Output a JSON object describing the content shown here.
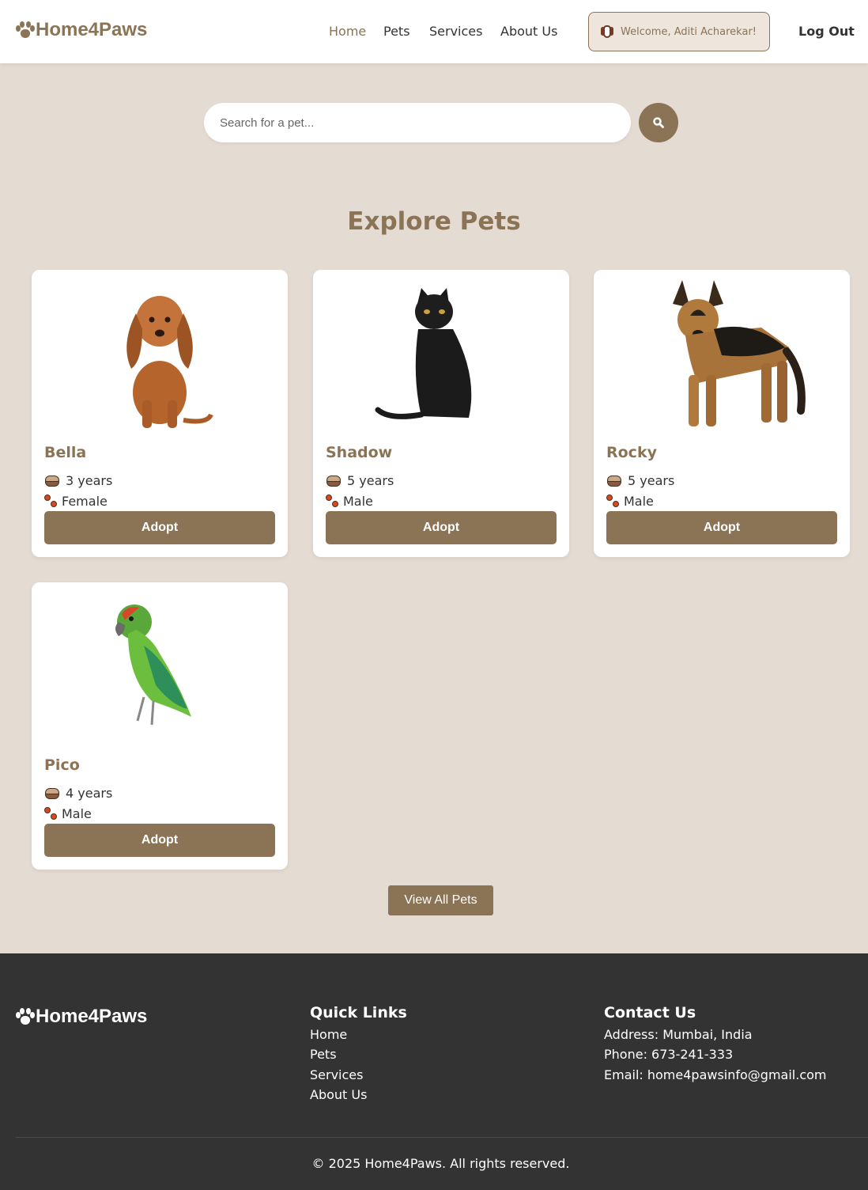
{
  "brand": {
    "name": "Home4Paws",
    "accent": "#8b7355",
    "background": "#e4dbd2",
    "footer_bg": "#333333"
  },
  "nav": {
    "items": [
      {
        "label": "Home",
        "active": true
      },
      {
        "label": "Pets",
        "active": false
      },
      {
        "label": "Services",
        "active": false
      },
      {
        "label": "About Us",
        "active": false
      }
    ],
    "welcome": "Welcome, Aditi Acharekar!",
    "logout": "Log Out"
  },
  "search": {
    "placeholder": "Search for a pet...",
    "icon": "search-icon"
  },
  "main": {
    "title": "Explore Pets",
    "pets": [
      {
        "name": "Bella",
        "age": "3 years",
        "gender": "Female",
        "button": "Adopt",
        "image": "dog-dachshund"
      },
      {
        "name": "Shadow",
        "age": "5 years",
        "gender": "Male",
        "button": "Adopt",
        "image": "black-cat"
      },
      {
        "name": "Rocky",
        "age": "5 years",
        "gender": "Male",
        "button": "Adopt",
        "image": "german-shepherd"
      },
      {
        "name": "Pico",
        "age": "4 years",
        "gender": "Male",
        "button": "Adopt",
        "image": "green-parrot"
      }
    ],
    "view_all": "View All Pets"
  },
  "footer": {
    "brand": "Home4Paws",
    "quick_links_title": "Quick Links",
    "quick_links": [
      "Home",
      "Pets",
      "Services",
      "About Us"
    ],
    "contact_title": "Contact Us",
    "contact": [
      "Address: Mumbai, India",
      "Phone: 673-241-333",
      "Email: home4pawsinfo@gmail.com"
    ],
    "copyright": "© 2025 Home4Paws. All rights reserved."
  }
}
